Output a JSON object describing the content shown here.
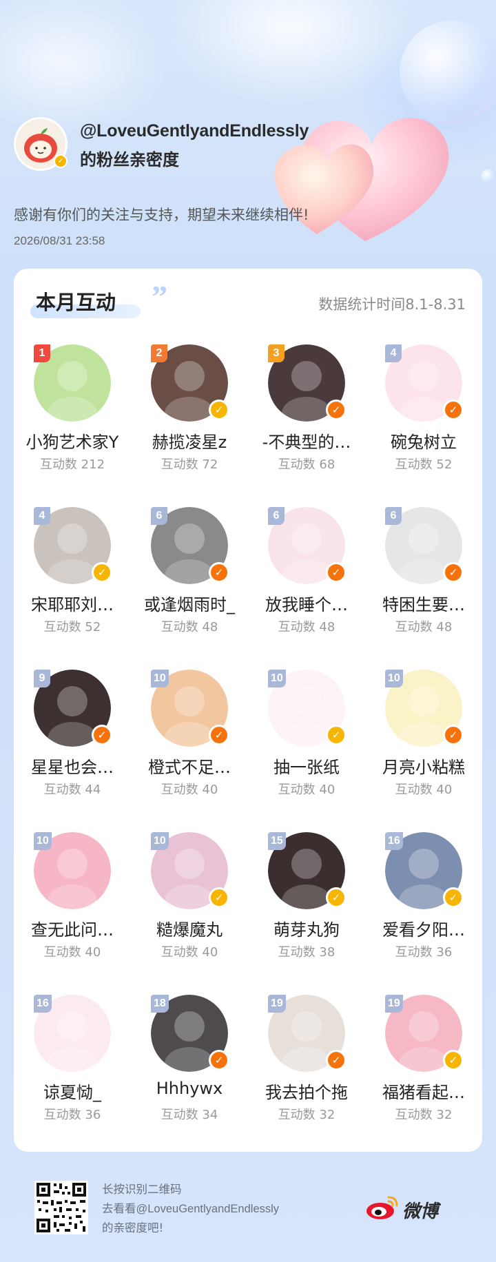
{
  "header": {
    "username": "@LoveuGentlyandEndlessly",
    "subtitle": "的粉丝亲密度",
    "thanks": "感谢有你们的关注与支持，期望未来继续相伴!",
    "datetime": "2026/08/31  23:58"
  },
  "card": {
    "title": "本月互动",
    "stats_range": "数据统计时间8.1-8.31",
    "fans": [
      {
        "rank": "1",
        "name": "小狗艺术家Y",
        "count": "互动数 212",
        "rank_color": "#f04a3e",
        "badge": "",
        "avatar_bg": "#bfe39c"
      },
      {
        "rank": "2",
        "name": "赫揽凌星z",
        "count": "互动数 72",
        "rank_color": "#f27a32",
        "badge": "yellow",
        "avatar_bg": "#6a4e46"
      },
      {
        "rank": "3",
        "name": "-不典型的…",
        "count": "互动数 68",
        "rank_color": "#f5a020",
        "badge": "orange",
        "avatar_bg": "#4a3a3c"
      },
      {
        "rank": "4",
        "name": "碗兔树立",
        "count": "互动数 52",
        "rank_color": "#a9b8d8",
        "badge": "orange",
        "avatar_bg": "#fde4ea"
      },
      {
        "rank": "4",
        "name": "宋耶耶刘…",
        "count": "互动数 52",
        "rank_color": "#a9b8d8",
        "badge": "yellow",
        "avatar_bg": "#c9c2bd"
      },
      {
        "rank": "6",
        "name": "或逢烟雨时_",
        "count": "互动数 48",
        "rank_color": "#a9b8d8",
        "badge": "orange",
        "avatar_bg": "#8a8a8a"
      },
      {
        "rank": "6",
        "name": "放我睡个…",
        "count": "互动数 48",
        "rank_color": "#a9b8d8",
        "badge": "orange",
        "avatar_bg": "#f9e4ea"
      },
      {
        "rank": "6",
        "name": "特困生要…",
        "count": "互动数 48",
        "rank_color": "#a9b8d8",
        "badge": "orange",
        "avatar_bg": "#e6e6e6"
      },
      {
        "rank": "9",
        "name": "星星也会…",
        "count": "互动数 44",
        "rank_color": "#a9b8d8",
        "badge": "orange",
        "avatar_bg": "#3c3030"
      },
      {
        "rank": "10",
        "name": "橙式不足…",
        "count": "互动数 40",
        "rank_color": "#a9b8d8",
        "badge": "orange",
        "avatar_bg": "#f2c7a0"
      },
      {
        "rank": "10",
        "name": "抽一张纸",
        "count": "互动数 40",
        "rank_color": "#a9b8d8",
        "badge": "yellow",
        "avatar_bg": "#fdf2f6"
      },
      {
        "rank": "10",
        "name": "月亮小粘糕",
        "count": "互动数 40",
        "rank_color": "#a9b8d8",
        "badge": "orange",
        "avatar_bg": "#fbf3c8"
      },
      {
        "rank": "10",
        "name": "查无此问…",
        "count": "互动数 40",
        "rank_color": "#a9b8d8",
        "badge": "",
        "avatar_bg": "#f7b6c6"
      },
      {
        "rank": "10",
        "name": "糙爆魔丸",
        "count": "互动数 40",
        "rank_color": "#a9b8d8",
        "badge": "yellow",
        "avatar_bg": "#e9c2d6"
      },
      {
        "rank": "15",
        "name": "萌芽丸狗",
        "count": "互动数 38",
        "rank_color": "#a9b8d8",
        "badge": "yellow",
        "avatar_bg": "#3a2e2e"
      },
      {
        "rank": "16",
        "name": "爱看夕阳…",
        "count": "互动数 36",
        "rank_color": "#a9b8d8",
        "badge": "yellow",
        "avatar_bg": "#7d8fb0"
      },
      {
        "rank": "16",
        "name": "谅夏恸_",
        "count": "互动数 36",
        "rank_color": "#a9b8d8",
        "badge": "",
        "avatar_bg": "#fbeaf0"
      },
      {
        "rank": "18",
        "name": "Hhhywx",
        "count": "互动数 34",
        "rank_color": "#a9b8d8",
        "badge": "orange",
        "avatar_bg": "#4e4a4e"
      },
      {
        "rank": "19",
        "name": "我去拍个拖",
        "count": "互动数 32",
        "rank_color": "#a9b8d8",
        "badge": "orange",
        "avatar_bg": "#e7e0da"
      },
      {
        "rank": "19",
        "name": "福猪看起…",
        "count": "互动数 32",
        "rank_color": "#a9b8d8",
        "badge": "yellow",
        "avatar_bg": "#f5b8c4"
      }
    ]
  },
  "footer": {
    "line1": "长按识别二维码",
    "line2": "去看看@LoveuGentlyandEndlessly",
    "line3": "的亲密度吧!",
    "brand": "微博",
    "qr_icon": "qr-code-icon",
    "logo_icon": "weibo-logo-icon"
  },
  "colors": {
    "badge_yellow": "#f7b400",
    "badge_orange": "#f5730a",
    "verified_check": "#f7b400"
  }
}
